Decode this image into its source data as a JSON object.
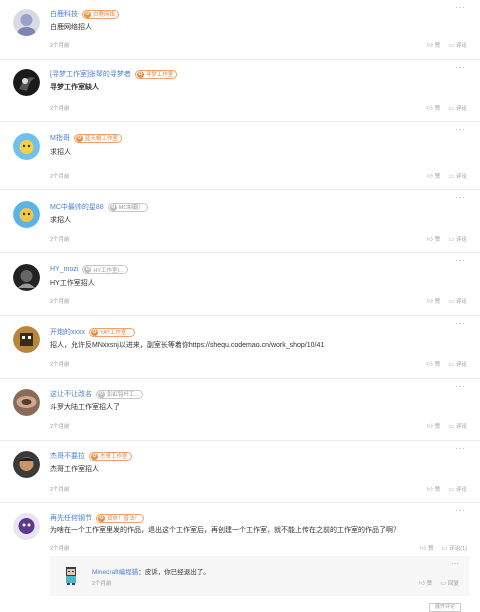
{
  "comments": [
    {
      "username": "白鹿科技",
      "badge": "白鹿网络",
      "content": "白鹿网络招人",
      "time": "2个月前",
      "like": "赞",
      "comment": "评论"
    },
    {
      "username": "[寻梦工作室]张琴的寻梦者",
      "badge": "寻梦工作室",
      "content": "寻梦工作室缺人",
      "time": "2个月前",
      "like": "赞",
      "comment": "评论"
    },
    {
      "username": "M指哥",
      "badge": "蓝天帽工作室",
      "content": "求招人",
      "time": "2个月前",
      "like": "赞",
      "comment": "评论"
    },
    {
      "username": "MC中最帅的星88",
      "badge": "MC制霸！",
      "content": "求招人",
      "time": "2个月前",
      "like": "赞",
      "comment": "评论"
    },
    {
      "username": "HY_mozi",
      "badge": "HY工作室I...",
      "content": "HY工作室招人",
      "time": "2个月前",
      "like": "赞",
      "comment": "评论"
    },
    {
      "username": "开炮的xxxx",
      "badge": "YAT工作室...",
      "content": "招人，允许反MNxxsnj以进来，副室长等着你https://shequ.codemao.cn/work_shop/10/41",
      "time": "2个月前",
      "like": "赞",
      "comment": "评论"
    },
    {
      "username": "这让不让改名",
      "badge": "彭虹铭杆工...",
      "content": "斗罗大陆工作室招人了",
      "time": "2个月前",
      "like": "赞",
      "comment": "评论"
    },
    {
      "username": "杰哥不要拉",
      "badge": "杰哥工作室",
      "content": "杰哥工作室招人",
      "time": "2个月前",
      "like": "赞",
      "comment": "评论"
    },
    {
      "username": "再先任何钢节",
      "badge": "双休！普法！",
      "content": "为啥在一个工作室里发的作品，退出这个工作室后，再创建一个工作室，就不能上传在之前的工作室的作品了啊？",
      "time": "2个月前",
      "like": "赞",
      "comment": "评论(1)"
    }
  ],
  "reply": {
    "username": "Minecraft编程猫",
    "text": "皮诉，你已经退出了。",
    "time": "2个月前",
    "like": "赞",
    "reply": "回复"
  },
  "more_icon": "···",
  "load_more": "展开评论"
}
